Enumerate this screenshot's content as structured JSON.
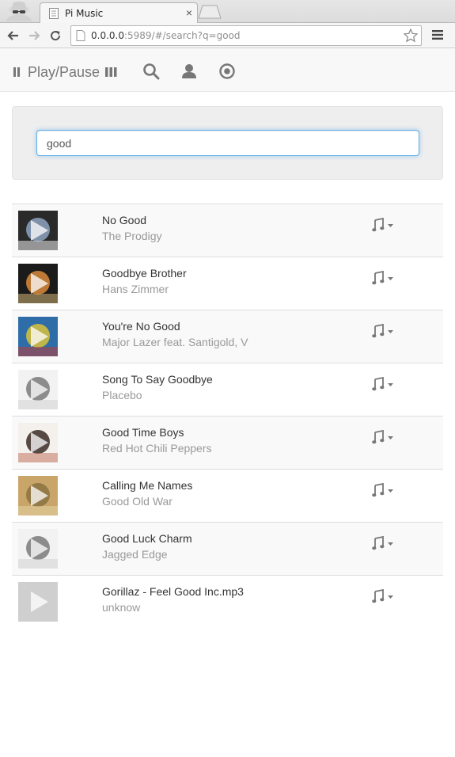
{
  "browser": {
    "tab_title": "Pi Music",
    "url_host": "0.0.0.0",
    "url_rest": ":5989/#/search?q=good"
  },
  "nav": {
    "playpause_label": "Play/Pause"
  },
  "icons": {
    "pause": "pause-icon",
    "library": "library-icon",
    "search": "search-icon",
    "user": "user-icon",
    "record": "record-icon",
    "music_dropdown": "music-note-icon"
  },
  "search": {
    "value": "good"
  },
  "colors": {
    "accent_focus": "#66afe9",
    "nav_text": "#777777",
    "artist_text": "#999999"
  },
  "results": [
    {
      "title": "No Good",
      "artist": "The Prodigy",
      "art": [
        "#2a2a2a",
        "#8ea3c0",
        "#ffffff"
      ]
    },
    {
      "title": "Goodbye Brother",
      "artist": "Hans Zimmer",
      "art": [
        "#1b1b1b",
        "#d98a3a",
        "#e2c27c"
      ]
    },
    {
      "title": "You're No Good",
      "artist": "Major Lazer feat. Santigold, V",
      "art": [
        "#2e6da8",
        "#d8c23a",
        "#c8382a"
      ]
    },
    {
      "title": "Song To Say Goodbye",
      "artist": "Placebo",
      "art": [
        "#f2f2f2",
        "#7a7a7a",
        "#cfcfcf"
      ]
    },
    {
      "title": "Good Time Boys",
      "artist": "Red Hot Chili Peppers",
      "art": [
        "#f4f0ec",
        "#3a2c26",
        "#c06a56"
      ]
    },
    {
      "title": "Calling Me Names",
      "artist": "Good Old War",
      "art": [
        "#c9a56a",
        "#8a7240",
        "#e8d8a8"
      ]
    },
    {
      "title": "Good Luck Charm",
      "artist": "Jagged Edge",
      "art": [
        "#f2f2f2",
        "#7a7a7a",
        "#cfcfcf"
      ]
    },
    {
      "title": "Gorillaz - Feel Good Inc.mp3",
      "artist": "unknow",
      "art": [
        "#cfcfcf",
        "#cfcfcf",
        "#cfcfcf"
      ]
    }
  ]
}
